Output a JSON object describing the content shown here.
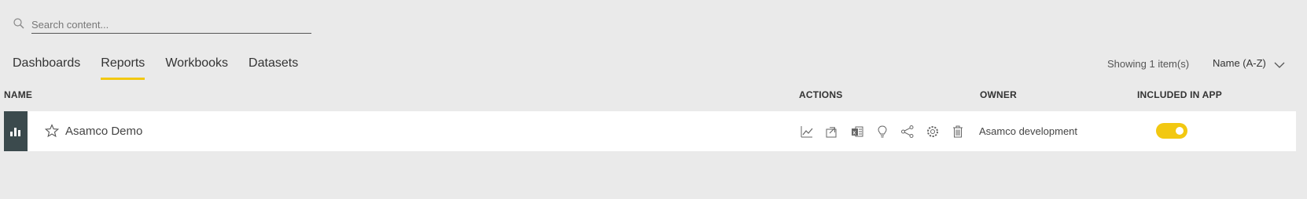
{
  "search": {
    "placeholder": "Search content...",
    "value": ""
  },
  "tabs": [
    {
      "label": "Dashboards",
      "active": false
    },
    {
      "label": "Reports",
      "active": true
    },
    {
      "label": "Workbooks",
      "active": false
    },
    {
      "label": "Datasets",
      "active": false
    }
  ],
  "status": {
    "count_text": "Showing 1 item(s)",
    "sort_label": "Name (A-Z)"
  },
  "columns": {
    "name": "NAME",
    "actions": "ACTIONS",
    "owner": "OWNER",
    "included": "INCLUDED IN APP"
  },
  "rows": [
    {
      "title": "Asamco Demo",
      "owner": "Asamco development",
      "included_in_app": true,
      "actions": [
        "line-chart-icon",
        "share-icon",
        "excel-icon",
        "lightbulb-icon",
        "share-nodes-icon",
        "settings-icon",
        "delete-icon"
      ]
    }
  ],
  "colors": {
    "accent": "#f2c811",
    "tile": "#3b4a4d",
    "background": "#eaeaea"
  }
}
